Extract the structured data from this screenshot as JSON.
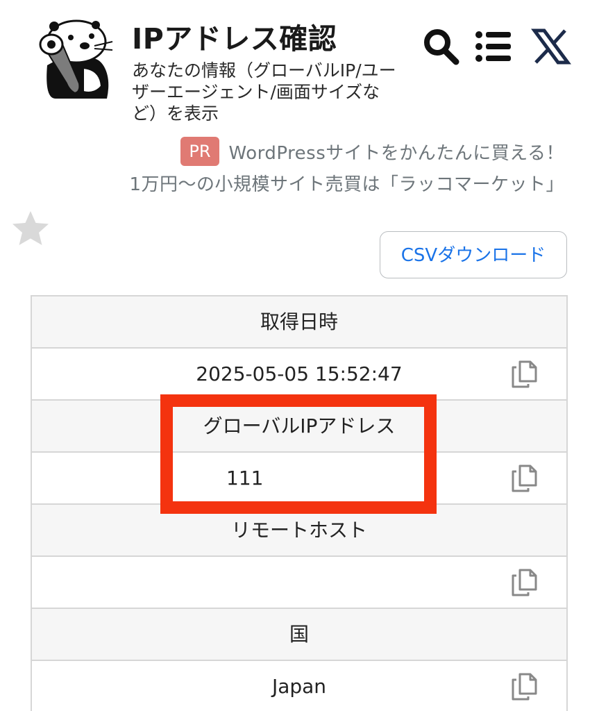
{
  "header": {
    "title": "IPアドレス確認",
    "subtitle": "あなたの情報（グローバルIP/ユーザーエージェント/画面サイズなど）を表示",
    "icons": [
      "search-icon",
      "menu-icon",
      "x-logo-icon"
    ]
  },
  "promo": {
    "badge": "PR",
    "line1": "WordPressサイトをかんたんに買える！",
    "line2": "1万円〜の小規模サイト売買は「ラッコマーケット」"
  },
  "toolbar": {
    "favorite_icon": "star-icon",
    "csv_label": "CSVダウンロード"
  },
  "table": {
    "rows": [
      {
        "label": "取得日時",
        "value": "2025-05-05 15:52:47"
      },
      {
        "label": "グローバルIPアドレス",
        "value": "111"
      },
      {
        "label": "リモートホスト",
        "value": ""
      },
      {
        "label": "国",
        "value": "Japan"
      }
    ]
  },
  "colors": {
    "accent_link": "#1a73e8",
    "pr_badge": "#e07a73",
    "highlight": "#f4330f",
    "header_row_bg": "#f6f6f6"
  }
}
